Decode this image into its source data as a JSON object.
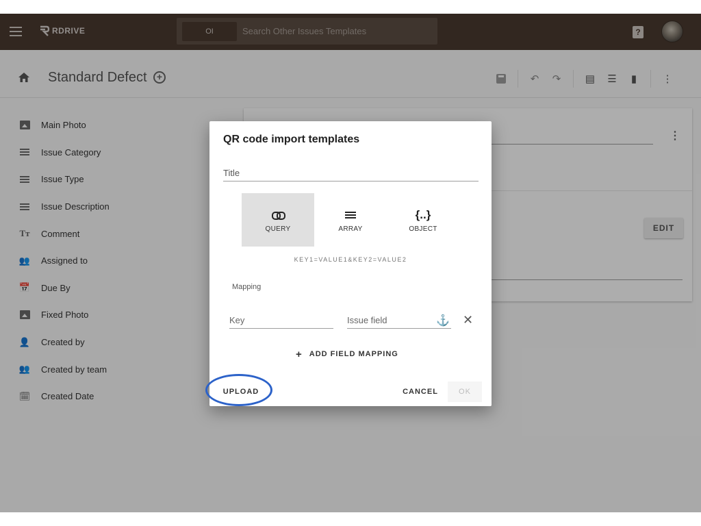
{
  "appbar": {
    "brand": "RDRIVE",
    "search_chip": "OI",
    "search_placeholder": "Search Other Issues Templates",
    "help_label": "?"
  },
  "header": {
    "title": "Standard Defect"
  },
  "sidebar": {
    "items": [
      {
        "label": "Main Photo",
        "icon": "photo-icon"
      },
      {
        "label": "Issue Category",
        "icon": "list-icon"
      },
      {
        "label": "Issue Type",
        "icon": "list-icon"
      },
      {
        "label": "Issue Description",
        "icon": "list-icon"
      },
      {
        "label": "Comment",
        "icon": "text-icon"
      },
      {
        "label": "Assigned to",
        "icon": "group-icon"
      },
      {
        "label": "Due By",
        "icon": "calendar-icon"
      },
      {
        "label": "Fixed Photo",
        "icon": "photo-icon"
      },
      {
        "label": "Created by",
        "icon": "person-icon"
      },
      {
        "label": "Created by team",
        "icon": "group-icon"
      },
      {
        "label": "Created Date",
        "icon": "calendar-edit-icon"
      }
    ]
  },
  "card": {
    "edit_label": "EDIT"
  },
  "dialog": {
    "title": "QR code import templates",
    "title_placeholder": "Title",
    "types": [
      {
        "label": "QUERY",
        "icon": "link-icon",
        "active": true
      },
      {
        "label": "ARRAY",
        "icon": "list-icon",
        "active": false
      },
      {
        "label": "OBJECT",
        "icon": "braces-icon",
        "active": false
      }
    ],
    "format_hint": "KEY1=VALUE1&KEY2=VALUE2",
    "mapping_label": "Mapping",
    "key_placeholder": "Key",
    "issue_field_label": "Issue field",
    "add_mapping_label": "ADD FIELD MAPPING",
    "upload_label": "UPLOAD",
    "cancel_label": "CANCEL",
    "ok_label": "OK"
  },
  "colors": {
    "appbar": "#4a3a30",
    "highlight": "#2c62c9"
  }
}
